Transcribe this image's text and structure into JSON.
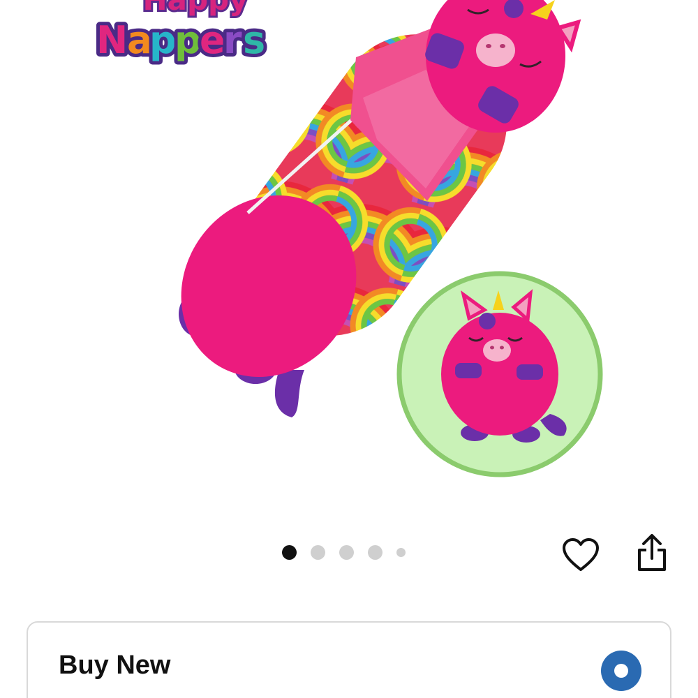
{
  "product_image": {
    "brand_logo_text": [
      "Happy",
      "Nappers"
    ],
    "carousel": {
      "dot_count": 5,
      "active_index": 0
    }
  },
  "actions": {
    "wishlist_icon": "heart-icon",
    "share_icon": "share-icon"
  },
  "buy_option": {
    "title": "Buy New",
    "selected": true
  },
  "colors": {
    "accent": "#2a6ab2",
    "product_pink": "#ec1b7e",
    "product_purple": "#6b2fa8",
    "inset_background": "#c9f2b7"
  }
}
